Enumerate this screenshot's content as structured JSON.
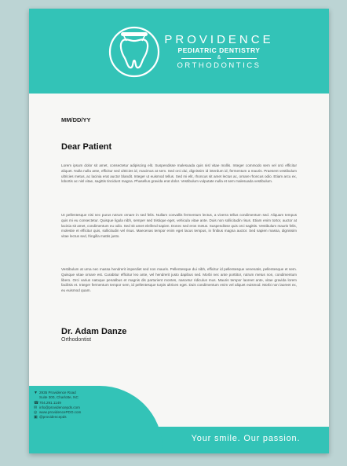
{
  "colors": {
    "accent": "#33c3b7",
    "background": "#bcd4d4",
    "paper": "#f7f7f5"
  },
  "header": {
    "logo_icon": "tooth-icon",
    "brand_line1": "PROVIDENCE",
    "brand_line2": "PEDIATRIC DENTISTRY",
    "brand_amp": "&",
    "brand_line3": "ORTHODONTICS"
  },
  "letter": {
    "date": "MM/DD/YY",
    "salutation": "Dear Patient",
    "paragraphs": [
      "Lorem ipsum dolor sit amet, consectetur adipiscing elit. Suspendisse malesuada quis nisl vitae mollis. Integer commodo sem vel orci efficitur aliquet. Nulla nulla ante, efficitur sed ultricies id, maximus at sem. Sed orci dui, dignissim id interdum id, fermentum a mauris. Praesent vestibulum ultricies metus, ac lacinia erat auctor blandit. Integer ut euismod tellus. Sed mi elit, rhoncus sit amet lectus ac, ornare rhoncus odio. Etiam arcu ex, lobortis ac nisl vitae, sagittis tincidunt magna. Phasellus gravida erat dolor. Vestibulum vulputate nulla et sem malesuada vestibulum.",
      "Ut pellentesque nisi nec purus rutrum ornare in sed felis. Nullam convallis fermentum lectus, a viverra tellus condimentum sed. Aliquam tempus quis mi eu consectetur. Quisque ligula nibh, semper sed tristique eget, vehicula vitae ante. Duis non sollicitudin risus. Etiam enim tortor, auctor at lacinia sit amet, condimentum eu odio. Sed sit amet eleifend sapien. Donec sed eros metus. Suspendisse quis orci sagittis. Vestibulum mauris felis, molestie et efficitur quis, sollicitudin vel risus. Maecenas tempor enim eget lacus tempus, in finibus magna auctor. Sed sapien massa, dignissim vitae lectus sed, fringilla mattis justo.",
      "Vestibulum at urna nec massa hendrerit imperdiet sed non mauris. Pellentesque dui nibh, efficitur id pellentesque venenatis, pellentesque et sem. Quisque vitae ornare est. Curabitur efficitur leo ante, vel hendrerit justo dapibus sed. Morbi nec ante porttitor, rutrum metus non, condimentum libero. Orci varius natoque penatibus et magnis dis parturient montes, nascetur ridiculus mus. Mauris tempor laoreet ante, vitae gravida lorem facilisis et. Integer fermentum tempor sem, id pellentesque turpis ultrices eget. Duis condimentum enim vel aliquet euismod. Morbi non laoreet ex, eu euismod quam."
    ],
    "signature_name": "Dr. Adam Danze",
    "signature_title": "Orthodontist"
  },
  "footer": {
    "contacts": [
      {
        "icon": "location-pin-icon",
        "glyph": "▼",
        "text": "2935 Providence Road"
      },
      {
        "icon": "",
        "glyph": "",
        "text": "Suite 300, Charlotte, NC"
      },
      {
        "icon": "phone-icon",
        "glyph": "☎",
        "text": "704.291.1149"
      },
      {
        "icon": "email-icon",
        "glyph": "✉",
        "text": "info@providencepds.com"
      },
      {
        "icon": "web-icon",
        "glyph": "◎",
        "text": "www.providencePDO.com"
      },
      {
        "icon": "social-icon",
        "glyph": "▣",
        "text": "@providencepds"
      }
    ],
    "slogan": "Your smile. Our passion."
  }
}
